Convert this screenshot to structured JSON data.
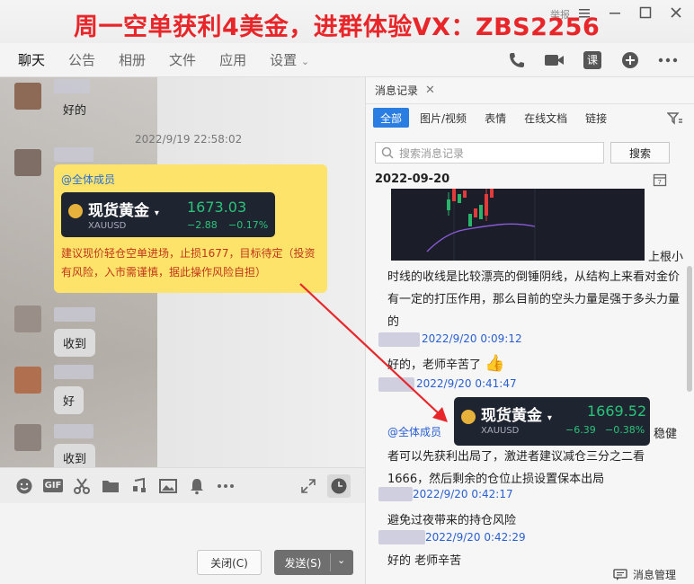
{
  "overlay_title": "周一空单获利4美金，进群体验VX：ZBS2256",
  "titlebar_small": "举报",
  "tabs": [
    "聊天",
    "公告",
    "相册",
    "文件",
    "应用",
    "设置"
  ],
  "tab_tools": [
    "phone-icon",
    "video-icon",
    "lesson-icon",
    "add-icon",
    "more-icon"
  ],
  "lesson_label": "课",
  "chat": {
    "msg_ok1": "好的",
    "timestamp": "2022/9/19 22:58:02",
    "at_all": "@全体成员",
    "quote": {
      "name": "现货黄金",
      "symbol": "XAUUSD",
      "price": "1673.03",
      "change": "−2.88",
      "pct": "−0.17%"
    },
    "advice": "建议现价轻仓空单进场，止损1677，目标待定（投资有风险，入市需谨慎，据此操作风险自担）",
    "msg_received1": "收到",
    "msg_ok2": "好",
    "msg_received2": "收到"
  },
  "toolbar_icons": [
    "emoji-icon",
    "gif-icon",
    "scissors-icon",
    "folder-icon",
    "music-icon",
    "image-icon",
    "bell-icon",
    "more-icon",
    "expand-icon",
    "history-icon"
  ],
  "gif_label": "GIF",
  "buttons": {
    "close": "关闭(C)",
    "send": "发送(S)"
  },
  "history": {
    "title": "消息记录",
    "filters": [
      "全部",
      "图片/视频",
      "表情",
      "在线文档",
      "链接"
    ],
    "search_placeholder": "搜索消息记录",
    "search_btn": "搜索",
    "date": "2022-09-20",
    "trailing_text": "上根小",
    "analysis": "时线的收线是比较漂亮的倒锤阴线，从结构上来看对金价有一定的打压作用，那么目前的空头力量是强于多头力量的",
    "meta1": "2022/9/20 0:09:12",
    "reply1": "好的，老师辛苦了",
    "meta2": "2022/9/20 0:41:47",
    "at_all": "@全体成员",
    "quote": {
      "name": "现货黄金",
      "symbol": "XAUUSD",
      "price": "1669.52",
      "change": "−6.39",
      "pct": "−0.38%"
    },
    "suffix": "稳健",
    "advice": "者可以先获利出局了，激进者建议减仓三分之二看1666，然后剩余的仓位止损设置保本出局",
    "meta3": "2022/9/20 0:42:17",
    "note": "避免过夜带来的持仓风险",
    "meta4": "2022/9/20 0:42:29",
    "reply2": "好的  老师辛苦",
    "manage": "消息管理"
  },
  "colors": {
    "accent": "#2a7de1",
    "overlay": "#e8262a",
    "quote_green": "#29c47a",
    "golden": "#fde36a",
    "arrow": "#e8262a"
  }
}
